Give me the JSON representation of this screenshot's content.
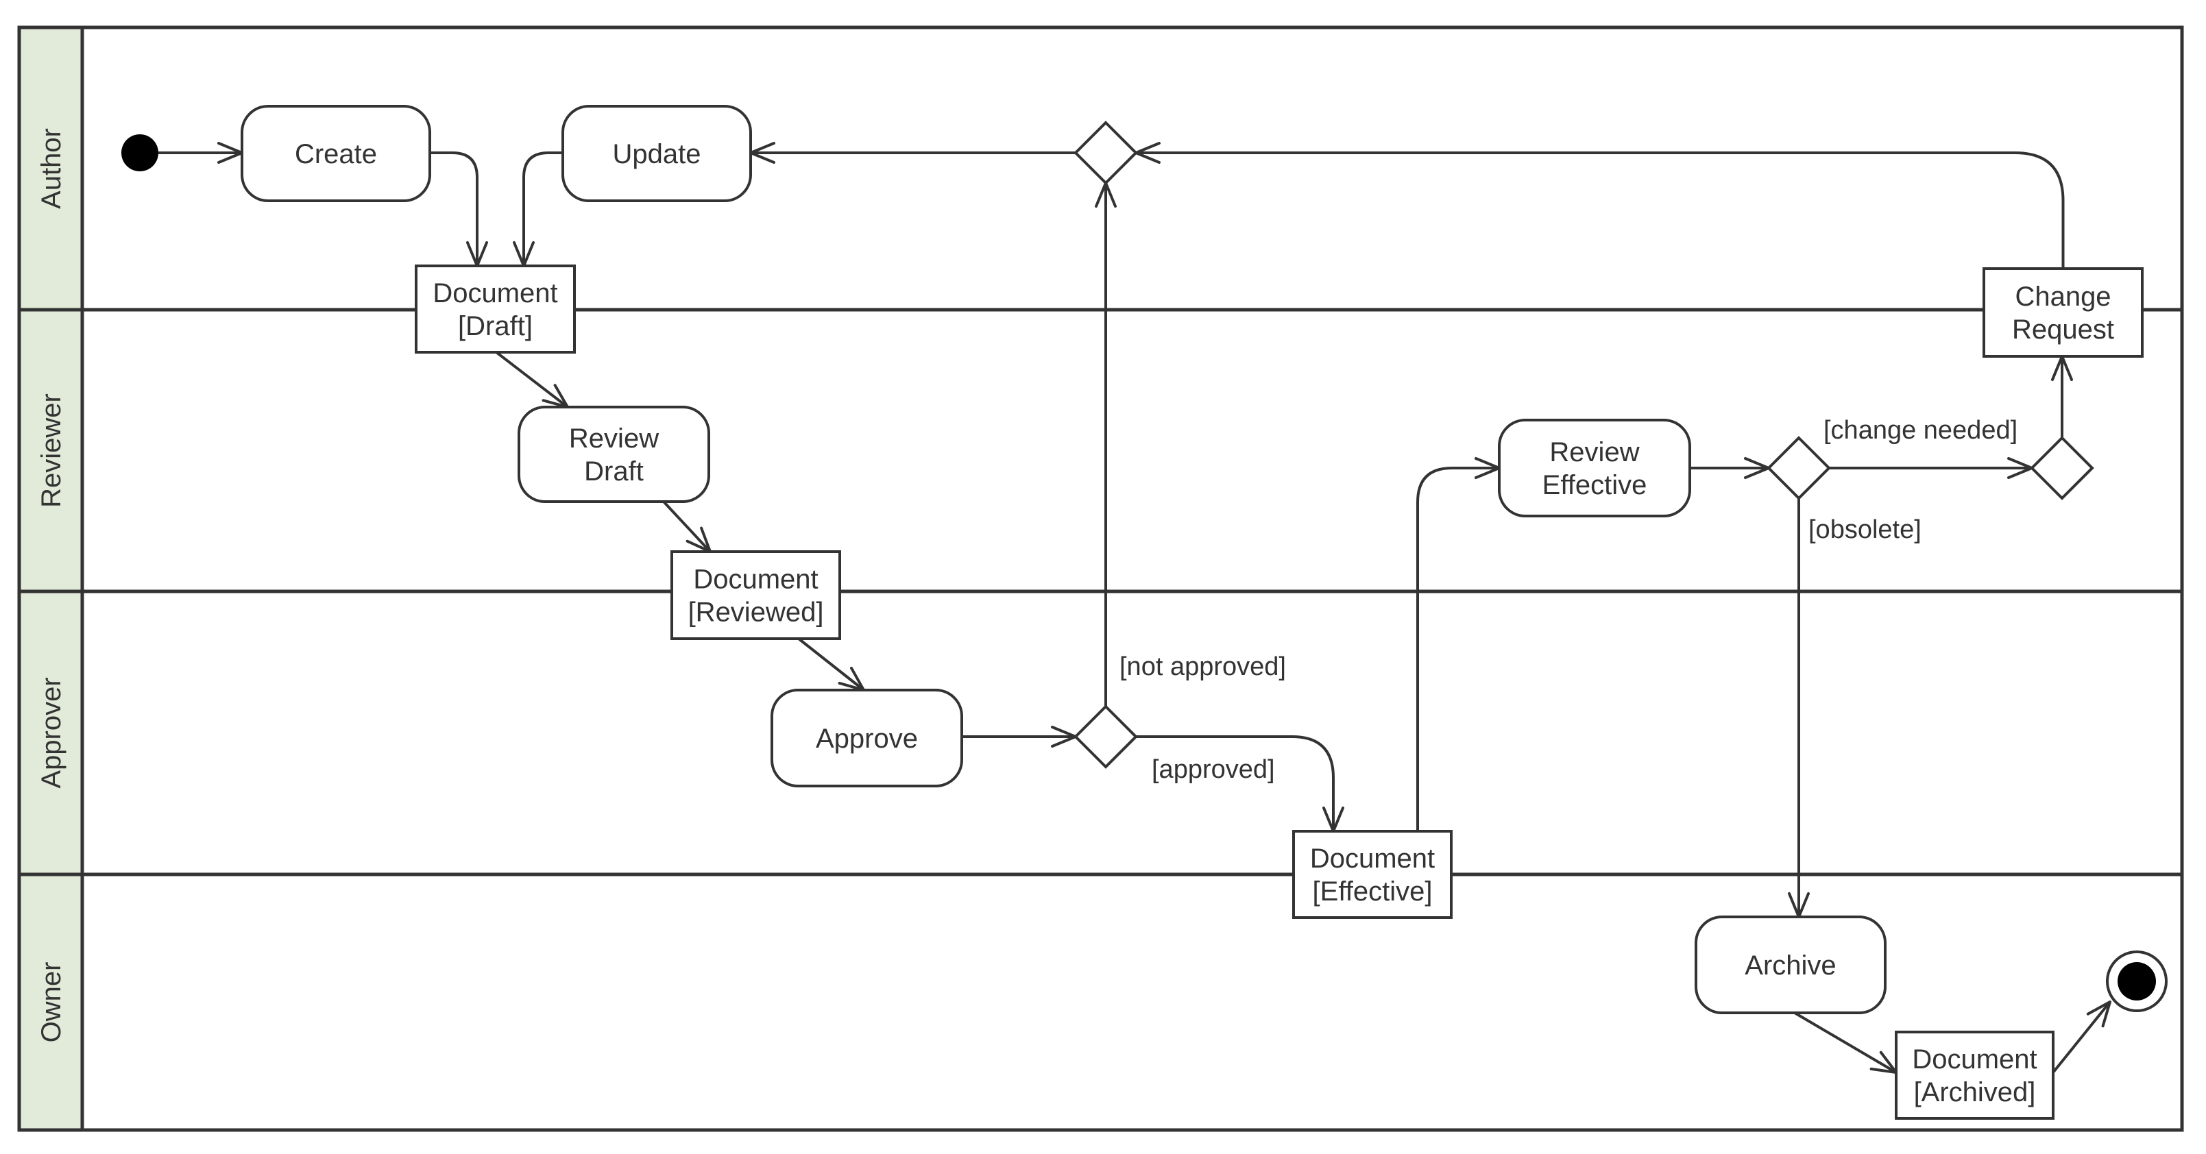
{
  "diagram": {
    "type": "UML activity diagram with swimlanes",
    "lanes": [
      {
        "id": "author",
        "label": "Author"
      },
      {
        "id": "reviewer",
        "label": "Reviewer"
      },
      {
        "id": "approver",
        "label": "Approver"
      },
      {
        "id": "owner",
        "label": "Owner"
      }
    ],
    "nodes": {
      "create": {
        "kind": "action",
        "lane": "Author",
        "lines": [
          "Create"
        ]
      },
      "update": {
        "kind": "action",
        "lane": "Author",
        "lines": [
          "Update"
        ]
      },
      "doc_draft": {
        "kind": "object",
        "lane": "Author/Reviewer",
        "lines": [
          "Document",
          "[Draft]"
        ]
      },
      "review_draft": {
        "kind": "action",
        "lane": "Reviewer",
        "lines": [
          "Review",
          "Draft"
        ]
      },
      "doc_reviewed": {
        "kind": "object",
        "lane": "Reviewer/Approver",
        "lines": [
          "Document",
          "[Reviewed]"
        ]
      },
      "approve": {
        "kind": "action",
        "lane": "Approver",
        "lines": [
          "Approve"
        ]
      },
      "doc_effective": {
        "kind": "object",
        "lane": "Approver/Owner",
        "lines": [
          "Document",
          "[Effective]"
        ]
      },
      "review_effective": {
        "kind": "action",
        "lane": "Reviewer",
        "lines": [
          "Review",
          "Effective"
        ]
      },
      "change_request": {
        "kind": "object",
        "lane": "Author/Reviewer",
        "lines": [
          "Change",
          "Request"
        ]
      },
      "archive": {
        "kind": "action",
        "lane": "Owner",
        "lines": [
          "Archive"
        ]
      },
      "doc_archived": {
        "kind": "object",
        "lane": "Owner",
        "lines": [
          "Document",
          "[Archived]"
        ]
      },
      "start": {
        "kind": "initial",
        "lane": "Author"
      },
      "end": {
        "kind": "final",
        "lane": "Owner"
      },
      "merge_update": {
        "kind": "decision",
        "lane": "Author"
      },
      "decision_approval": {
        "kind": "decision",
        "lane": "Approver"
      },
      "decision_review": {
        "kind": "decision",
        "lane": "Reviewer"
      },
      "merge_change": {
        "kind": "decision",
        "lane": "Reviewer"
      }
    },
    "edges": [
      {
        "from": "start",
        "to": "create",
        "guard": ""
      },
      {
        "from": "create",
        "to": "doc_draft",
        "guard": ""
      },
      {
        "from": "update",
        "to": "doc_draft",
        "guard": ""
      },
      {
        "from": "doc_draft",
        "to": "review_draft",
        "guard": ""
      },
      {
        "from": "review_draft",
        "to": "doc_reviewed",
        "guard": ""
      },
      {
        "from": "doc_reviewed",
        "to": "approve",
        "guard": ""
      },
      {
        "from": "approve",
        "to": "decision_approval",
        "guard": ""
      },
      {
        "from": "decision_approval",
        "to": "merge_update",
        "guard": "[not approved]"
      },
      {
        "from": "decision_approval",
        "to": "doc_effective",
        "guard": "[approved]"
      },
      {
        "from": "merge_update",
        "to": "update",
        "guard": ""
      },
      {
        "from": "doc_effective",
        "to": "review_effective",
        "guard": ""
      },
      {
        "from": "review_effective",
        "to": "decision_review",
        "guard": ""
      },
      {
        "from": "decision_review",
        "to": "merge_change",
        "guard": "[change needed]"
      },
      {
        "from": "decision_review",
        "to": "archive",
        "guard": "[obsolete]"
      },
      {
        "from": "merge_change",
        "to": "change_request",
        "guard": ""
      },
      {
        "from": "change_request",
        "to": "merge_update",
        "guard": ""
      },
      {
        "from": "archive",
        "to": "doc_archived",
        "guard": ""
      },
      {
        "from": "doc_archived",
        "to": "end",
        "guard": ""
      }
    ],
    "guards": {
      "not_approved": "[not approved]",
      "approved": "[approved]",
      "change_needed": "[change needed]",
      "obsolete": "[obsolete]"
    },
    "colors": {
      "lane_header_fill": "#e2ebd9",
      "stroke": "#333333",
      "initial_fill": "#000000"
    }
  }
}
